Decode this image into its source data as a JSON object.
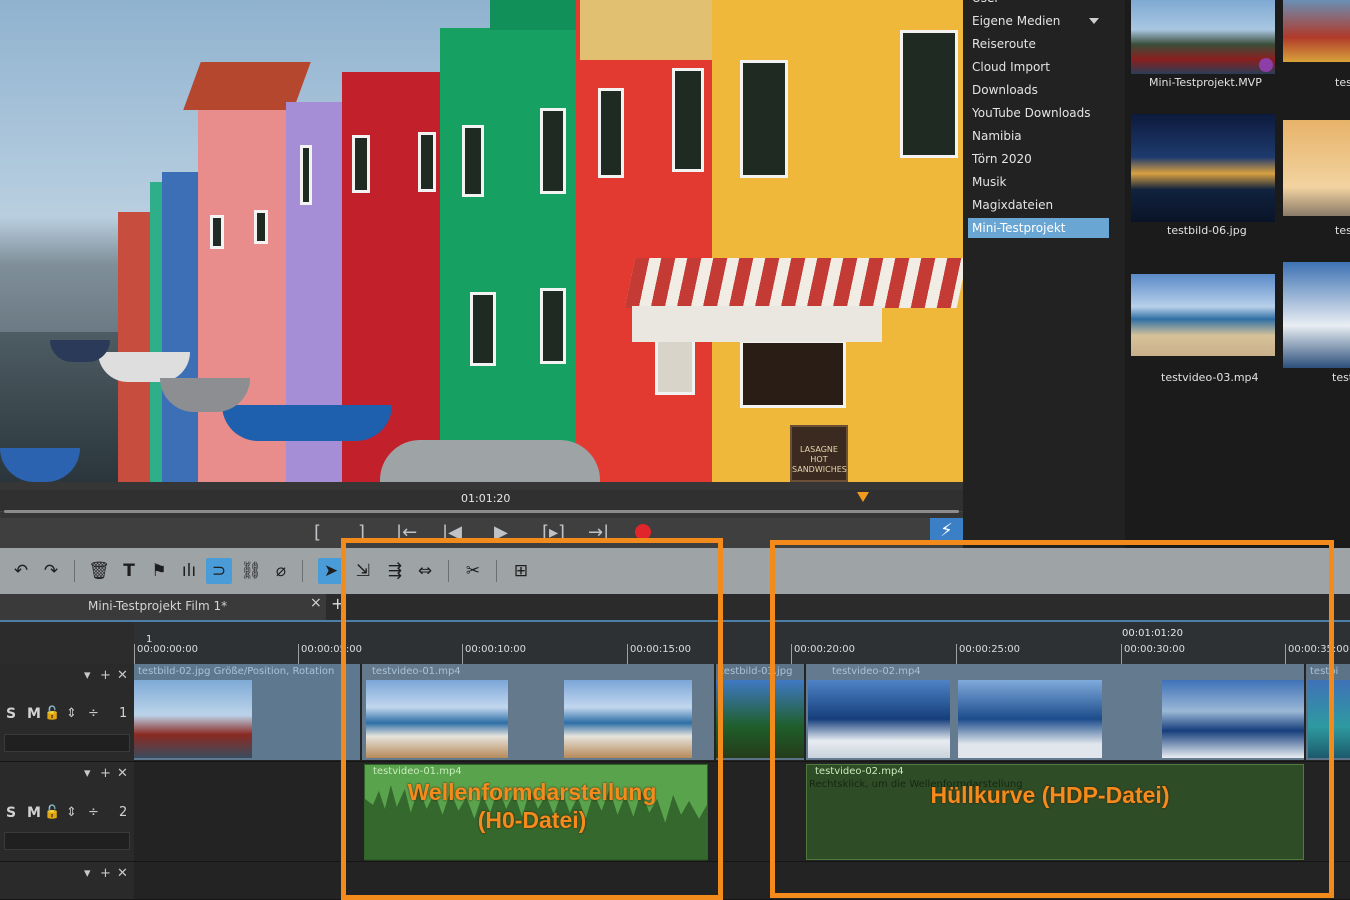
{
  "preview": {
    "timecode": "01:01:20",
    "sign_lines": [
      "LASAGNE",
      "HOT",
      "SANDWICHES"
    ]
  },
  "transport": {
    "buttons": [
      "[",
      "]",
      "|←",
      "|◀",
      "▶",
      "[▸]",
      "→|"
    ],
    "lightning": "⚡"
  },
  "media_pool": {
    "folder_partial": "User",
    "folders": [
      "Eigene Medien",
      "Reiseroute",
      "Cloud Import",
      "Downloads",
      "YouTube Downloads",
      "Namibia",
      "Törn 2020",
      "Musik",
      "Magixdateien",
      "Mini-Testprojekt"
    ],
    "active_folder": "Mini-Testprojekt",
    "thumbs": [
      {
        "label": "Mini-Testprojekt.MVP"
      },
      {
        "label": "testbil"
      },
      {
        "label": "testbild-06.jpg"
      },
      {
        "label": "testbil"
      },
      {
        "label": "testvideo-03.mp4"
      },
      {
        "label": "testvid"
      }
    ]
  },
  "toolbar": {
    "icons": [
      "undo-icon",
      "redo-icon",
      "delete-icon",
      "title-icon",
      "marker-icon",
      "level-icon",
      "magnet-icon",
      "link-icon",
      "unlink-icon",
      "pointer-icon",
      "pointer-range-icon",
      "pointer-track-icon",
      "stretch-icon",
      "razor-icon",
      "insert-icon"
    ]
  },
  "tabs": {
    "project_tab": "Mini-Testprojekt Film 1*",
    "close": "×",
    "add": "+"
  },
  "ruler": {
    "marker_label": "1",
    "current_time": "00:01:01:20",
    "ticks": [
      "00:00:00:00",
      "00:00:05:00",
      "00:00:10:00",
      "00:00:15:00",
      "00:00:20:00",
      "00:00:25:00",
      "00:00:30:00",
      "00:00:35:00"
    ]
  },
  "tracks": [
    {
      "number": "1",
      "solo_mute": "S M"
    },
    {
      "number": "2",
      "solo_mute": "S M"
    }
  ],
  "clips": {
    "video": [
      {
        "title": "testbild-02.jpg   Größe/Position, Rotation"
      },
      {
        "title": "testvideo-01.mp4"
      },
      {
        "title": "testbild-03.jpg"
      },
      {
        "title": "testvideo-02.mp4"
      },
      {
        "title": "testbi"
      }
    ],
    "audio": [
      {
        "title": "testvideo-01.mp4"
      },
      {
        "title": "testvideo-02.mp4",
        "hint": "Rechtsklick, um die Wellenformdarstellung"
      }
    ]
  },
  "annotations": {
    "left_line1": "Wellenformdarstellung",
    "left_line2": "(H0-Datei)",
    "right": "Hüllkurve (HDP-Datei)",
    "color": "#f28a1c"
  }
}
